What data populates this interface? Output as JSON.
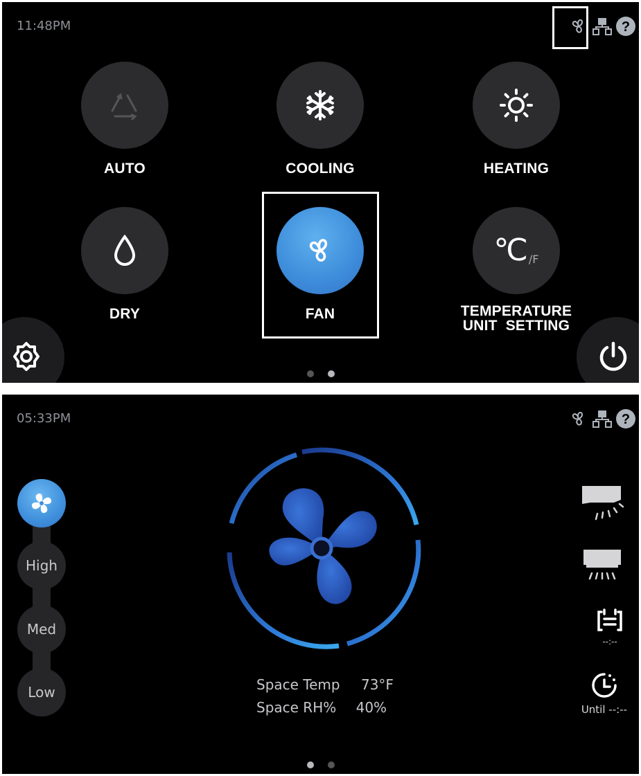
{
  "screen1": {
    "time": "11:48PM",
    "status_icons": [
      "fan-icon",
      "network-icon",
      "help-icon"
    ],
    "modes": [
      {
        "label": "AUTO",
        "icon": "auto-cycle-icon",
        "active": false
      },
      {
        "label": "COOLING",
        "icon": "snowflake-icon",
        "active": false
      },
      {
        "label": "HEATING",
        "icon": "sun-icon",
        "active": false
      },
      {
        "label": "DRY",
        "icon": "droplet-icon",
        "active": false
      },
      {
        "label": "FAN",
        "icon": "fan-icon",
        "active": true
      },
      {
        "label": "TEMPERATURE\nUNIT  SETTING",
        "icon": "celsius-fahrenheit-icon",
        "active": false
      }
    ],
    "temp_unit_glyph": "℃",
    "temp_unit_alt": "/F",
    "page_dots": 2,
    "active_dot": 1
  },
  "screen2": {
    "time": "05:33PM",
    "status_icons": [
      "fan-icon",
      "network-icon",
      "help-icon"
    ],
    "fan_speeds": [
      "High",
      "Med",
      "Low"
    ],
    "space_temp_label": "Space Temp",
    "space_temp_value": "73°F",
    "space_rh_label": "Space RH%",
    "space_rh_value": "40%",
    "schedule_value": "--:--",
    "timer_value": "Until --:--",
    "active_dot": 0
  },
  "colors": {
    "accent": "#3f8fdc",
    "highlight_dash": "#c1272d",
    "panel_bg": "#000000",
    "button_bg": "#2c2c2e"
  }
}
